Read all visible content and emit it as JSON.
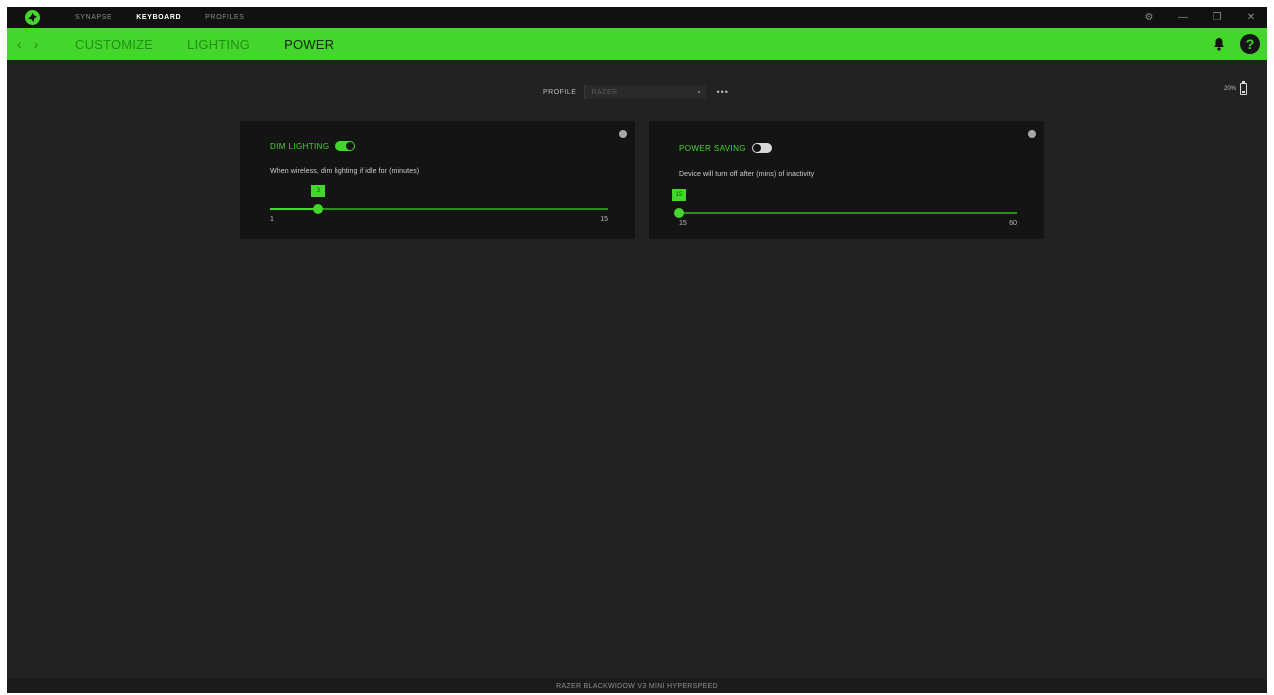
{
  "topnav": {
    "items": [
      {
        "label": "SYNAPSE",
        "active": false
      },
      {
        "label": "KEYBOARD",
        "active": true
      },
      {
        "label": "PROFILES",
        "active": false
      }
    ]
  },
  "window_controls": {
    "settings": "⚙",
    "minimize": "—",
    "maximize": "❐",
    "close": "✕"
  },
  "subnav": {
    "back_arrow": "‹",
    "forward_arrow": "›",
    "tabs": [
      {
        "label": "CUSTOMIZE",
        "active": false
      },
      {
        "label": "LIGHTING",
        "active": false
      },
      {
        "label": "POWER",
        "active": true
      }
    ],
    "help_label": "?"
  },
  "profile": {
    "label": "PROFILE",
    "value": "RAZER",
    "chevron": "▾",
    "more": "•••"
  },
  "battery": {
    "percent_label": "20%",
    "level": 0.2
  },
  "cards": [
    {
      "title": "DIM LIGHTING",
      "toggle_on": true,
      "description": "When wireless, dim lighting if idle for (minutes)",
      "slider": {
        "min": 1,
        "max": 15,
        "value": 3,
        "value_label": "3",
        "min_label": "1",
        "max_label": "15"
      }
    },
    {
      "title": "POWER SAVING",
      "toggle_on": false,
      "description": "Device will turn off after (mins) of inactivity",
      "slider": {
        "min": 15,
        "max": 60,
        "value": 15,
        "value_label": "15",
        "min_label": "15",
        "max_label": "60"
      }
    }
  ],
  "footer": {
    "device_name": "RAZER BLACKWIDOW V3 MINI HYPERSPEED"
  },
  "colors": {
    "accent": "#44d62c",
    "background": "#222222",
    "card": "#141414",
    "titlebar": "#111111"
  },
  "icons": {
    "logo": "razer-logo-icon",
    "bell": "bell-icon",
    "help": "help-icon",
    "info": "info-icon",
    "battery": "battery-icon",
    "more": "more-icon"
  }
}
